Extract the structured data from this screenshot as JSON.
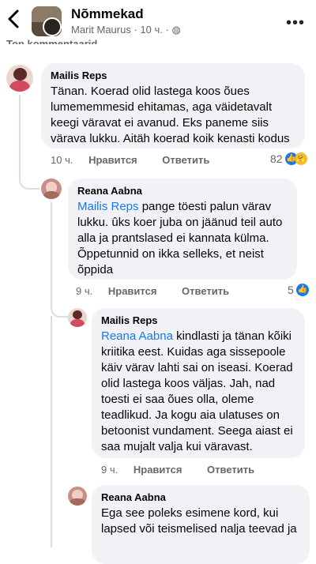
{
  "header": {
    "group_name": "Nõmmekad",
    "author": "Marit Maurus",
    "time": "10 ч.",
    "globe": "◌",
    "cut_label": "Top kommentaarid"
  },
  "comments": [
    {
      "author": "Mailis Reps",
      "mention": "",
      "text": "Tänan. Koerad olid lastega koos õues lumememmesid ehitamas, aga väidetavalt keegi väravat ei avanud. Eks paneme siis värava lukku. Aitäh koerad koik kenasti kodus",
      "time": "10 ч.",
      "like": "Нравится",
      "reply": "Ответить",
      "reactions": "82"
    },
    {
      "author": "Reana Aabna",
      "mention": "Mailis Reps",
      "text": " pange töesti palun värav lukku. ûks koer juba on jäänud teil auto alla ja prantslased ei kannata külma. Õppetunnid on ikka selleks, et neist õppida",
      "time": "9 ч.",
      "like": "Нравится",
      "reply": "Ответить",
      "reactions": "5"
    },
    {
      "author": "Mailis Reps",
      "mention": "Reana Aabna",
      "text": " kindlasti ja tänan kõiki kriitika eest. Kuidas aga sissepoole käiv värav lahti sai on iseasi. Koerad olid lastega koos väljas. Jah, nad toesti ei saa õues olla, oleme teadlikud. Ja kogu aia ulatuses on betoonist vundament. Seega aiast ei saa mujalt valja kui väravast.",
      "time": "9 ч.",
      "like": "Нравится",
      "reply": "Ответить"
    },
    {
      "author": "Reana Aabna",
      "mention": "",
      "text": "Ega see poleks esimene kord, kui lapsed või teismelised nalja teevad ja"
    }
  ]
}
